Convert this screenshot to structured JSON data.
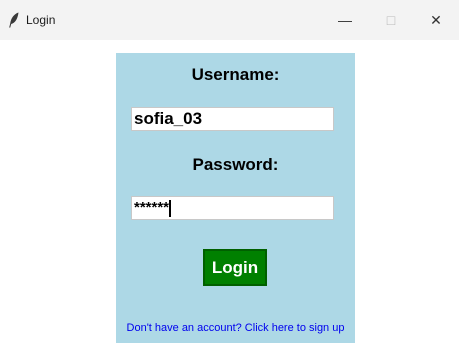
{
  "window": {
    "title": "Login",
    "icon": "feather-icon",
    "controls": {
      "minimize": "—",
      "maximize": "□",
      "close": "✕"
    }
  },
  "form": {
    "username_label": "Username:",
    "username_value": "sofia_03",
    "password_label": "Password:",
    "password_masked": "******",
    "login_label": "Login",
    "signup_link": "Don't have an account? Click here to sign up"
  },
  "colors": {
    "panel_bg": "#add8e6",
    "login_button": "#008000",
    "link": "#0000ee"
  }
}
